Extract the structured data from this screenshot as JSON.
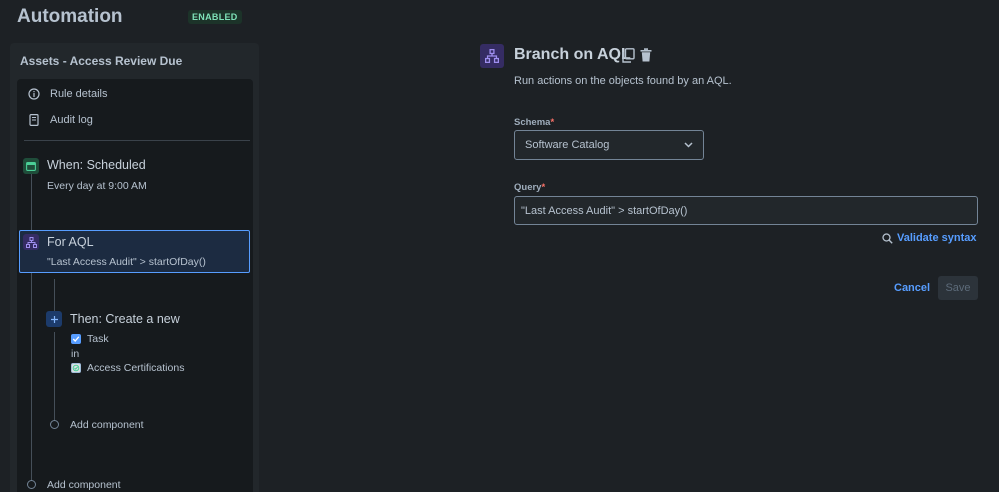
{
  "header": {
    "title": "Automation",
    "status_badge": "ENABLED"
  },
  "rule": {
    "name": "Assets - Access Review Due",
    "menu": [
      {
        "label": "Rule details",
        "icon": "info-icon"
      },
      {
        "label": "Audit log",
        "icon": "document-icon"
      }
    ],
    "trigger": {
      "title": "When: Scheduled",
      "subtitle": "Every day at 9:00 AM",
      "icon": "calendar-icon"
    },
    "branch": {
      "title": "For AQL",
      "subtitle": "\"Last Access Audit\" > startOfDay()",
      "icon": "hierarchy-icon"
    },
    "action": {
      "title": "Then: Create a new",
      "object_type": "Task",
      "in_label": "in",
      "schema": "Access Certifications",
      "icon": "plus-icon"
    },
    "add_component_inner": "Add component",
    "add_component_outer": "Add component"
  },
  "detail": {
    "title": "Branch on AQL",
    "description": "Run actions on the objects found by an AQL.",
    "schema_label": "Schema",
    "schema_value": "Software Catalog",
    "query_label": "Query",
    "query_value": "\"Last Access Audit\" > startOfDay()",
    "validate_label": "Validate syntax",
    "cancel_label": "Cancel",
    "save_label": "Save",
    "required_marker": "*"
  },
  "colors": {
    "accent": "#579dff",
    "enabled_bg": "#1c3329",
    "enabled_text": "#7ee2b8",
    "branch_icon_bg": "#352c63",
    "trigger_icon_bg": "#1f4d3a",
    "action_icon_bg": "#1c3b6b"
  }
}
